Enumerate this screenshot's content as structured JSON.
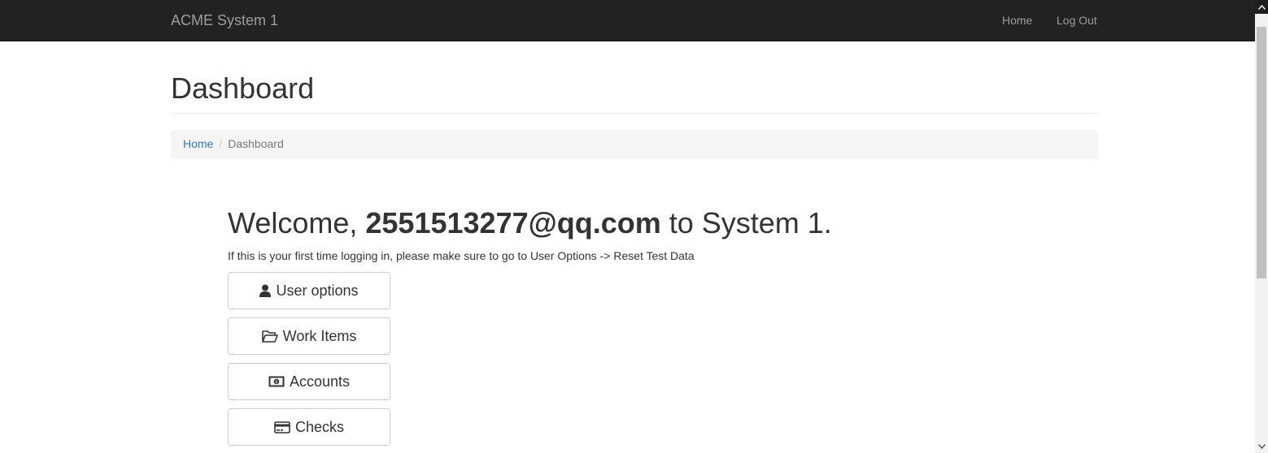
{
  "navbar": {
    "brand": "ACME System 1",
    "links": {
      "home": "Home",
      "logout": "Log Out"
    }
  },
  "page": {
    "title": "Dashboard"
  },
  "breadcrumb": {
    "home": "Home",
    "separator": "/",
    "current": "Dashboard"
  },
  "welcome": {
    "prefix": "Welcome, ",
    "user": "2551513277@qq.com",
    "suffix": " to System 1.",
    "note": "If this is your first time logging in, please make sure to go to User Options -> Reset Test Data"
  },
  "buttons": {
    "user_options": {
      "label": "User options",
      "icon": "user-icon"
    },
    "work_items": {
      "label": "Work Items",
      "icon": "folder-open-icon"
    },
    "accounts": {
      "label": "Accounts",
      "icon": "money-icon"
    },
    "checks": {
      "label": "Checks",
      "icon": "credit-card-icon"
    }
  },
  "colors": {
    "navbar_bg": "#222222",
    "navbar_text": "#9d9d9d",
    "link": "#337ab7",
    "breadcrumb_bg": "#f5f5f5"
  }
}
